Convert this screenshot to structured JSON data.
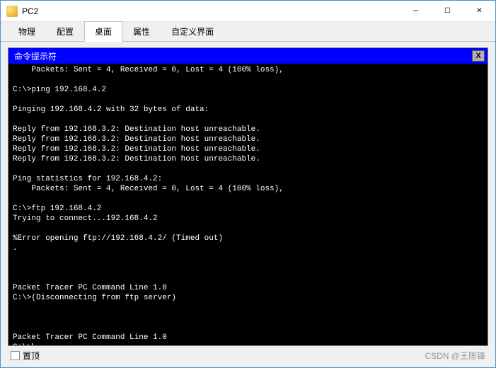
{
  "window": {
    "title": "PC2",
    "min_icon": "─",
    "max_icon": "☐",
    "close_icon": "✕"
  },
  "tabs": [
    {
      "label": "物理",
      "active": false
    },
    {
      "label": "配置",
      "active": false
    },
    {
      "label": "桌面",
      "active": true
    },
    {
      "label": "属性",
      "active": false
    },
    {
      "label": "自定义界面",
      "active": false
    }
  ],
  "terminal": {
    "title": "命令提示符",
    "close_label": "X",
    "lines": [
      "    Packets: Sent = 4, Received = 0, Lost = 4 (100% loss),",
      "",
      "C:\\>ping 192.168.4.2",
      "",
      "Pinging 192.168.4.2 with 32 bytes of data:",
      "",
      "Reply from 192.168.3.2: Destination host unreachable.",
      "Reply from 192.168.3.2: Destination host unreachable.",
      "Reply from 192.168.3.2: Destination host unreachable.",
      "Reply from 192.168.3.2: Destination host unreachable.",
      "",
      "Ping statistics for 192.168.4.2:",
      "    Packets: Sent = 4, Received = 0, Lost = 4 (100% loss),",
      "",
      "C:\\>ftp 192.168.4.2",
      "Trying to connect...192.168.4.2",
      "",
      "%Error opening ftp://192.168.4.2/ (Timed out)",
      ".",
      "",
      "",
      "",
      "Packet Tracer PC Command Line 1.0",
      "C:\\>(Disconnecting from ftp server)",
      "",
      "",
      "",
      "Packet Tracer PC Command Line 1.0",
      "C:\\>"
    ]
  },
  "bottom": {
    "checkbox_label": "置顶",
    "watermark": "CSDN @王陈锋"
  }
}
